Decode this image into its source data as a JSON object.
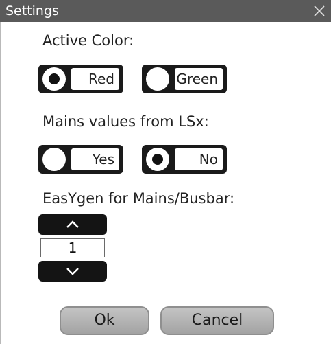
{
  "window": {
    "title": "Settings"
  },
  "active_color": {
    "label": "Active Color:",
    "options": [
      {
        "label": "Red",
        "selected": true
      },
      {
        "label": "Green",
        "selected": false
      }
    ]
  },
  "mains_values": {
    "label": "Mains values from LSx:",
    "options": [
      {
        "label": "Yes",
        "selected": false
      },
      {
        "label": "No",
        "selected": true
      }
    ]
  },
  "easygen": {
    "label": "EasYgen for Mains/Busbar:",
    "value": "1"
  },
  "buttons": {
    "ok": "Ok",
    "cancel": "Cancel"
  },
  "icons": {
    "close": "close-icon",
    "up": "chevron-up-icon",
    "down": "chevron-down-icon"
  }
}
